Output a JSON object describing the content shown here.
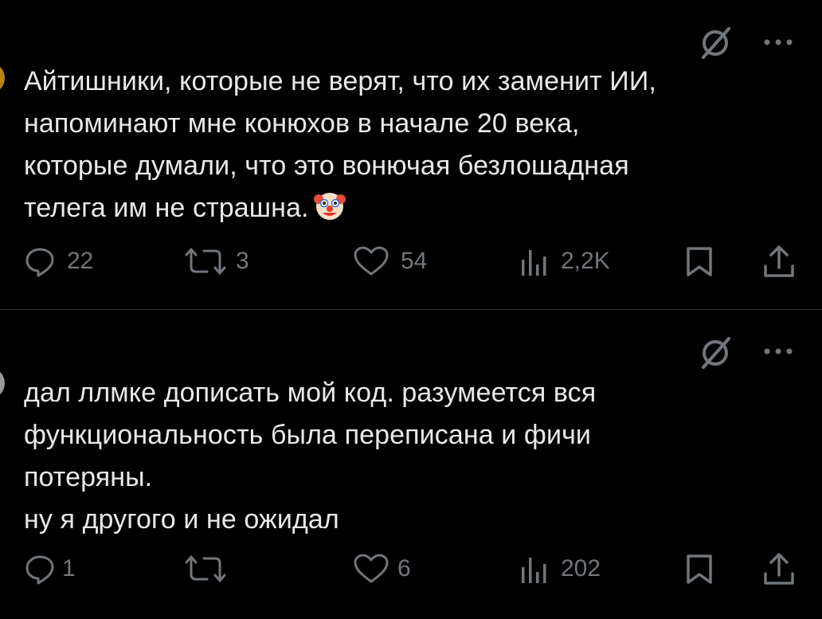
{
  "posts": [
    {
      "text": "Айтишники, которые не верят, что их заменит ИИ,\nнапоминают мне конюхов в начале 20 века,\nкоторые думали, что это вонючая безлошадная\nтелега им не страшна.",
      "emoji": "clown-face",
      "actions": {
        "replies": "22",
        "reposts": "3",
        "likes": "54",
        "views": "2,2K"
      }
    },
    {
      "text": "дал ллмке дописать мой код. разумеется вся\nфункциональность была переписана и фичи\nпотеряны.\nну я другого и не ожидал",
      "actions": {
        "replies": "1",
        "reposts": "",
        "likes": "6",
        "views": "202"
      }
    }
  ],
  "icons": {
    "top_right": [
      "grok-icon",
      "more-icon"
    ],
    "actions": [
      "reply-icon",
      "repost-icon",
      "like-icon",
      "views-icon",
      "bookmark-icon",
      "share-icon"
    ]
  },
  "colors": {
    "background": "#000000",
    "text": "#e7e9ea",
    "muted": "#71767b",
    "divider": "#2f3336"
  }
}
